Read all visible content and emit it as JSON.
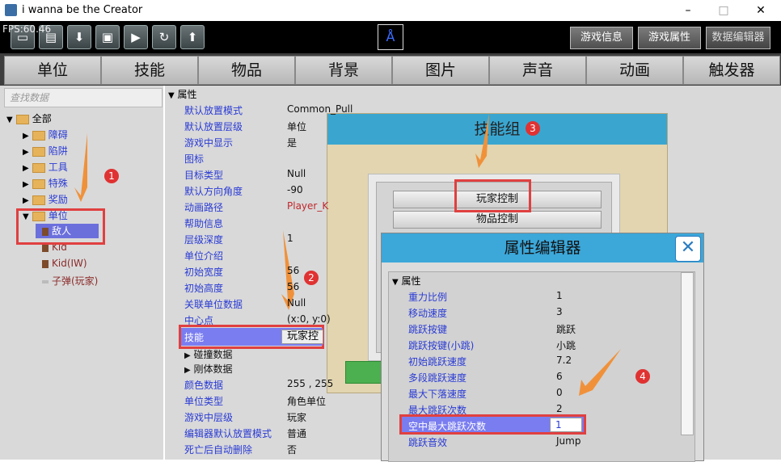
{
  "window": {
    "title": "i wanna be the Creator",
    "minimize": "–",
    "maximize": "□",
    "close": "✕"
  },
  "toolbar": {
    "fps": "FPS:60.46",
    "buttons": [
      "new-file-icon",
      "open-file-icon",
      "download-icon",
      "save-icon",
      "play-icon",
      "refresh-icon",
      "upload-icon"
    ],
    "right_buttons": [
      "游戏信息",
      "游戏属性",
      "数据编辑器"
    ]
  },
  "tabs": [
    "单位",
    "技能",
    "物品",
    "背景",
    "图片",
    "声音",
    "动画",
    "触发器"
  ],
  "left": {
    "search_placeholder": "查找数据",
    "root": "全部",
    "folders": [
      "障碍",
      "陷阱",
      "工具",
      "特殊",
      "奖励",
      "单位"
    ],
    "units": [
      "敌人",
      "Kid",
      "Kid(IW)",
      "子弹(玩家)"
    ]
  },
  "props": {
    "section": "属性",
    "rows": [
      [
        "默认放置模式",
        "Common_Pull"
      ],
      [
        "默认放置层级",
        "单位"
      ],
      [
        "游戏中显示",
        "是"
      ],
      [
        "图标",
        ""
      ],
      [
        "目标类型",
        "Null"
      ],
      [
        "默认方向角度",
        "-90"
      ],
      [
        "动画路径",
        "Player_K"
      ],
      [
        "帮助信息",
        ""
      ],
      [
        "层级深度",
        "1"
      ],
      [
        "单位介绍",
        ""
      ],
      [
        "初始宽度",
        "56"
      ],
      [
        "初始高度",
        "56"
      ],
      [
        "关联单位数据",
        "Null"
      ],
      [
        "中心点",
        "(x:0, y:0)"
      ]
    ],
    "skill_label": "技能",
    "skill_value": "玩家控",
    "collapsed1": "碰撞数据",
    "collapsed2": "刚体数据",
    "rows2": [
      [
        "颜色数据",
        "255 , 255"
      ],
      [
        "单位类型",
        "角色单位"
      ],
      [
        "游戏中层级",
        "玩家"
      ],
      [
        "编辑器默认放置模式",
        "普通"
      ],
      [
        "死亡后自动删除",
        "否"
      ]
    ]
  },
  "skill_dialog": {
    "title": "技能组",
    "items": [
      "玩家控制",
      "物品控制"
    ]
  },
  "prop_editor": {
    "title": "属性编辑器",
    "close": "✕",
    "section": "属性",
    "rows": [
      [
        "重力比例",
        "1"
      ],
      [
        "移动速度",
        "3"
      ],
      [
        "跳跃按键",
        "跳跃"
      ],
      [
        "跳跃按键(小跳)",
        "小跳"
      ],
      [
        "初始跳跃速度",
        "7.2"
      ],
      [
        "多段跳跃速度",
        "6"
      ],
      [
        "最大下落速度",
        "0"
      ],
      [
        "最大跳跃次数",
        "2"
      ]
    ],
    "highlight_label": "空中最大跳跃次数",
    "highlight_value": "1",
    "after": [
      [
        "跳跃音效",
        "Jump"
      ]
    ]
  },
  "annotations": [
    "1",
    "2",
    "3",
    "4"
  ],
  "colors": {
    "accent": "#3aa6d0",
    "highlight": "#7a7df0",
    "annotation": "#e04040",
    "arrow": "#f0913a"
  }
}
